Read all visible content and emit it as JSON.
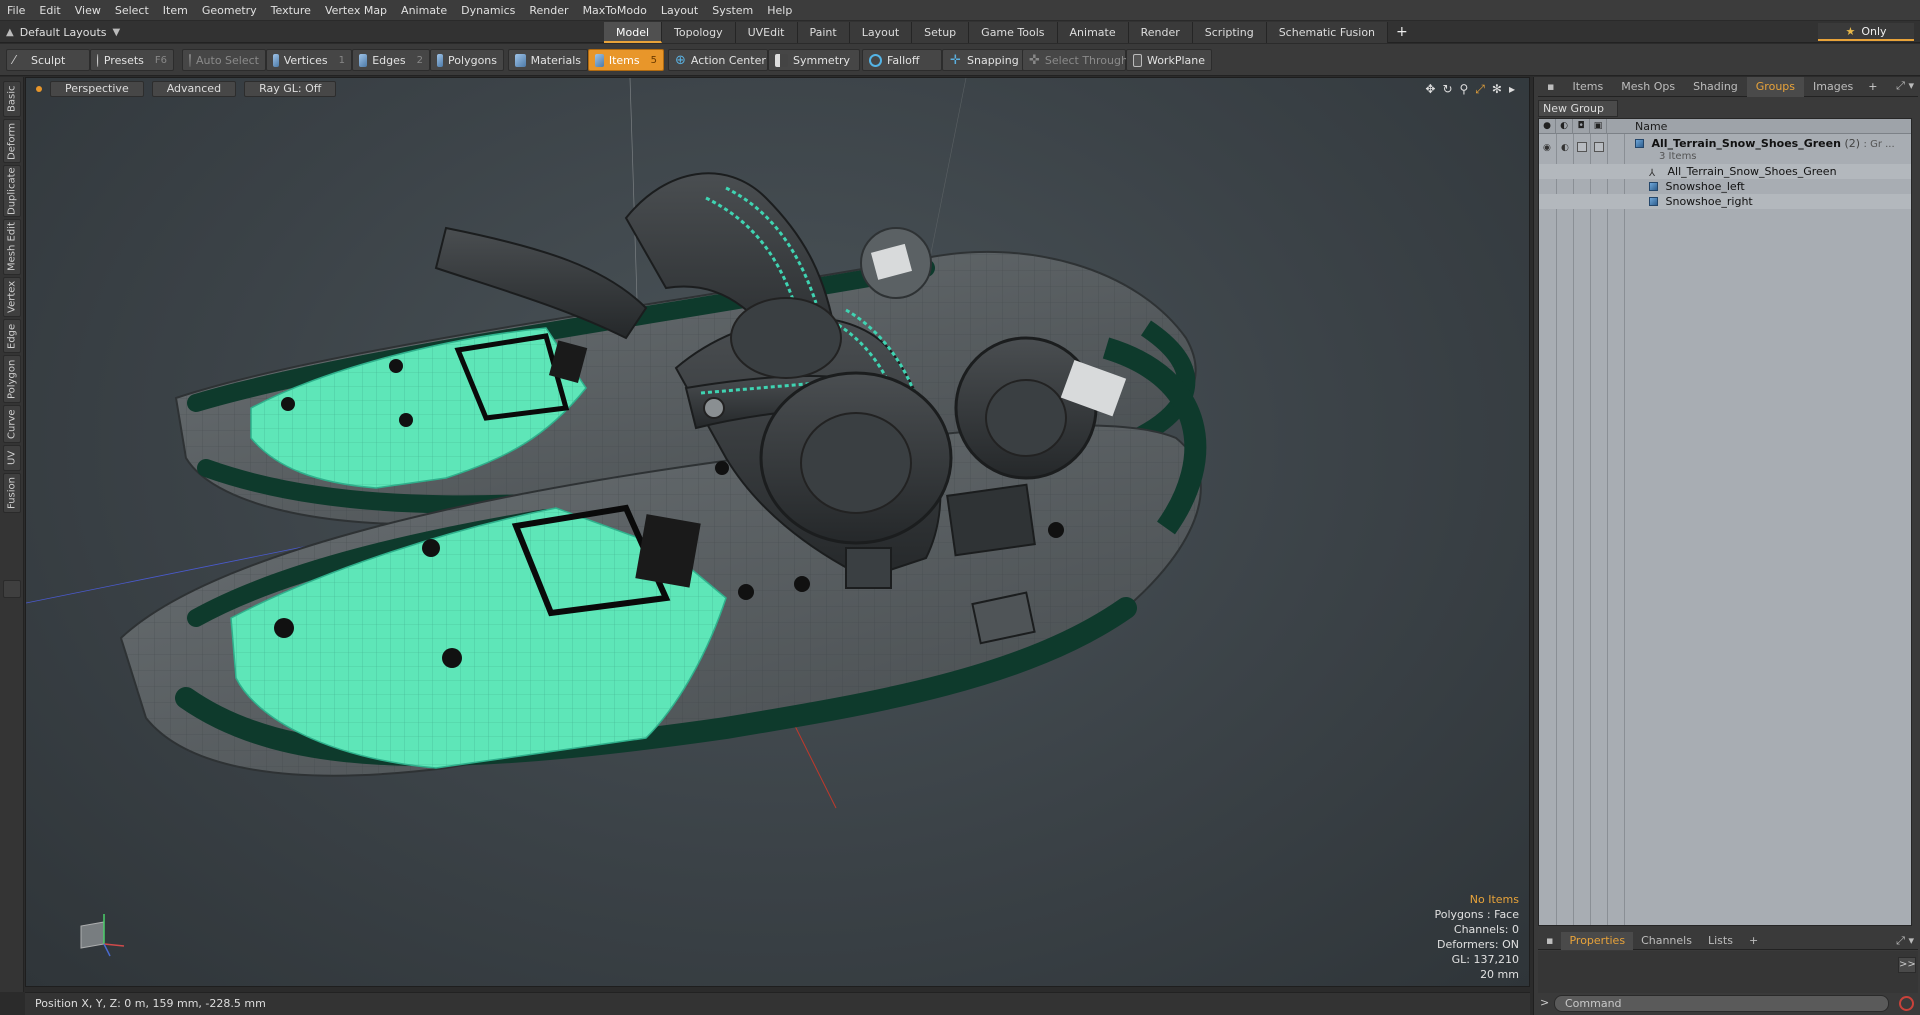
{
  "menu": [
    "File",
    "Edit",
    "View",
    "Select",
    "Item",
    "Geometry",
    "Texture",
    "Vertex Map",
    "Animate",
    "Dynamics",
    "Render",
    "MaxToModo",
    "Layout",
    "System",
    "Help"
  ],
  "layout_dropdown": "Default Layouts",
  "tabs": [
    {
      "label": "Model",
      "active": true
    },
    {
      "label": "Topology"
    },
    {
      "label": "UVEdit"
    },
    {
      "label": "Paint"
    },
    {
      "label": "Layout"
    },
    {
      "label": "Setup"
    },
    {
      "label": "Game Tools"
    },
    {
      "label": "Animate"
    },
    {
      "label": "Render"
    },
    {
      "label": "Scripting"
    },
    {
      "label": "Schematic Fusion"
    }
  ],
  "tabs_plus": "+",
  "only_label": "Only",
  "toolbar": {
    "sculpt": "Sculpt",
    "presets": "Presets",
    "presets_key": "F6",
    "auto_select": "Auto Select",
    "vertices": "Vertices",
    "vertices_key": "1",
    "edges": "Edges",
    "edges_key": "2",
    "polygons": "Polygons",
    "materials": "Materials",
    "items": "Items",
    "items_key": "5",
    "action_center": "Action Center",
    "symmetry": "Symmetry",
    "falloff": "Falloff",
    "snapping": "Snapping",
    "select_through": "Select Through",
    "workplane": "WorkPlane"
  },
  "left_tabs": [
    "Basic",
    "Deform",
    "Duplicate",
    "Mesh Edit",
    "Vertex",
    "Edge",
    "Polygon",
    "Curve",
    "UV",
    "Fusion"
  ],
  "viewport": {
    "view": "Perspective",
    "shading": "Advanced",
    "raygl": "Ray GL: Off",
    "info": {
      "items": "No Items",
      "polygons": "Polygons : Face",
      "channels": "Channels: 0",
      "deformers": "Deformers: ON",
      "gl": "GL: 137,210",
      "scale": "20 mm"
    },
    "colors": {
      "uv_fill": "#5ee6b8",
      "frame": "#0e3a2c",
      "body": "#5b6164",
      "accent": "#3fd4b2"
    }
  },
  "status": "Position X, Y, Z:  0 m, 159 mm, -228.5 mm",
  "right_panel": {
    "tabs": [
      {
        "label": "Items"
      },
      {
        "label": "Mesh Ops"
      },
      {
        "label": "Shading"
      },
      {
        "label": "Groups",
        "active": true
      },
      {
        "label": "Images"
      }
    ],
    "new_group": "New Group",
    "col_name": "Name",
    "tree": [
      {
        "label": "All_Terrain_Snow_Shoes_Green",
        "count": "(2)",
        "suffix": ": Gr ...",
        "sub": "3 Items",
        "level": 0,
        "icon": "group"
      },
      {
        "label": "All_Terrain_Snow_Shoes_Green",
        "level": 1,
        "icon": "locator"
      },
      {
        "label": "Snowshoe_left",
        "level": 1,
        "icon": "mesh"
      },
      {
        "label": "Snowshoe_right",
        "level": 1,
        "icon": "mesh"
      }
    ],
    "lower_tabs": [
      {
        "label": "Properties",
        "active": true
      },
      {
        "label": "Channels"
      },
      {
        "label": "Lists"
      }
    ],
    "command_placeholder": "Command"
  }
}
